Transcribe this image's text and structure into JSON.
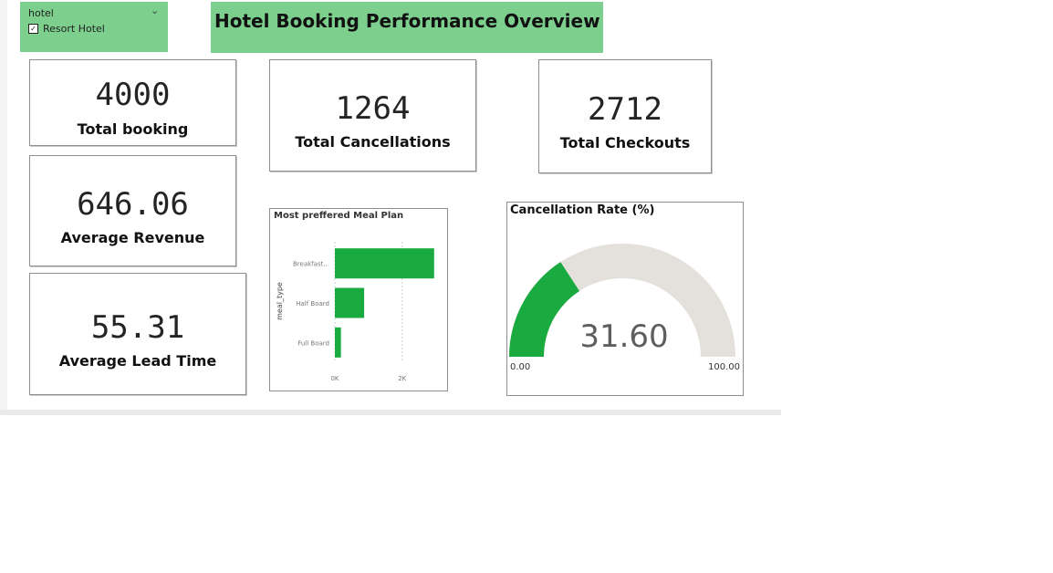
{
  "slicer": {
    "title": "hotel",
    "chevron": "⌄",
    "item_label": "Resort Hotel",
    "item_checked_glyph": "✓"
  },
  "header": {
    "title": "Hotel Booking Performance Overview"
  },
  "kpis": {
    "total_booking": {
      "value": "4000",
      "label": "Total booking"
    },
    "total_cancellations": {
      "value": "1264",
      "label": "Total Cancellations"
    },
    "total_checkouts": {
      "value": "2712",
      "label": "Total Checkouts"
    },
    "average_revenue": {
      "value": "646.06",
      "label": "Average Revenue"
    },
    "average_lead_time": {
      "value": "55.31",
      "label": "Average Lead Time"
    }
  },
  "colors": {
    "accent_green": "#1aab40",
    "banner_green": "#7ccf8c",
    "gauge_track": "#e4e0dc"
  },
  "chart_data": [
    {
      "type": "bar",
      "orientation": "horizontal",
      "title": "Most preffered Meal Plan",
      "ylabel": "meal_type",
      "xlabel": "",
      "categories": [
        "Breakfast...",
        "Half Board",
        "Full Board"
      ],
      "values": [
        2950,
        870,
        180
      ],
      "xlim": [
        0,
        3200
      ],
      "xticks": [
        0,
        2000
      ],
      "xtick_labels": [
        "0K",
        "2K"
      ],
      "grid": true
    },
    {
      "type": "gauge",
      "title": "Cancellation Rate (%)",
      "value": 31.6,
      "value_label": "31.60",
      "min": 0,
      "max": 100,
      "min_label": "0.00",
      "max_label": "100.00"
    }
  ]
}
